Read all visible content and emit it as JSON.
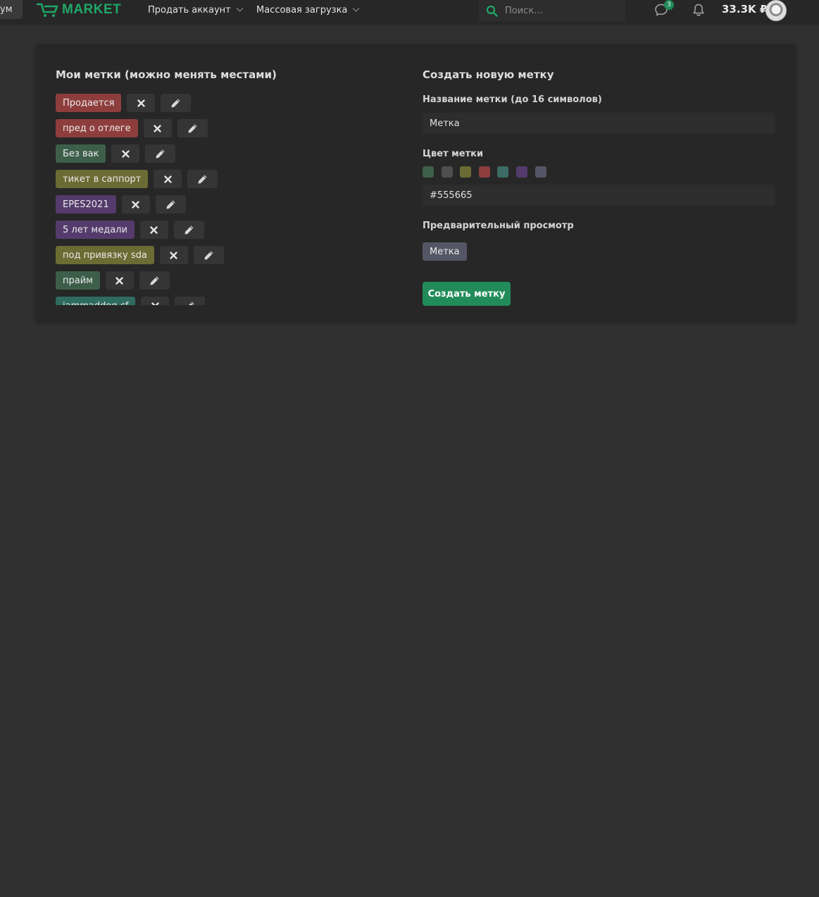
{
  "header": {
    "forum_tab_label": "ум",
    "logo_text": "MARKET",
    "nav": [
      {
        "label": "Продать аккаунт"
      },
      {
        "label": "Массовая загрузка"
      }
    ],
    "search_placeholder": "Поиск...",
    "messages_badge": "3",
    "balance": "33.3K ₽",
    "accent_color": "#1fa767"
  },
  "left": {
    "title": "Мои метки (можно менять местами)",
    "tags": [
      {
        "label": "Продается",
        "color": "#8e3d3d"
      },
      {
        "label": "пред о отлеге",
        "color": "#8e3d3d"
      },
      {
        "label": "Без вак",
        "color": "#3d5f4a"
      },
      {
        "label": "тикет в саппорт",
        "color": "#6b6b34"
      },
      {
        "label": "EPES2021",
        "color": "#553b6b"
      },
      {
        "label": "5 лет медали",
        "color": "#553b6b"
      },
      {
        "label": "под привязку sda",
        "color": "#6b6b34"
      },
      {
        "label": "прайм",
        "color": "#3d5f4a"
      },
      {
        "label": "jammaddog cf",
        "color": "#2f6b5f"
      }
    ]
  },
  "right": {
    "title": "Создать новую метку",
    "name_label": "Название метки (до 16 символов)",
    "name_value": "Метка",
    "color_label": "Цвет метки",
    "swatches": [
      "#3d5f4a",
      "#4e4e4e",
      "#6b6b34",
      "#8e3d3d",
      "#3d6b66",
      "#553b6b",
      "#555665"
    ],
    "color_value": "#555665",
    "preview_label": "Предварительный просмотр",
    "preview_text": "Метка",
    "preview_color": "#555665",
    "create_button": "Создать метку"
  }
}
